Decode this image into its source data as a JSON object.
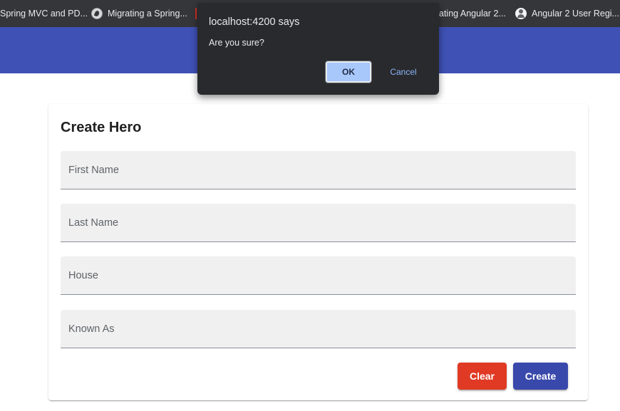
{
  "browser": {
    "bookmarks": [
      {
        "label": "Spring MVC and PD...",
        "icon": "bookmark-icon"
      },
      {
        "label": "Migrating a Spring...",
        "icon": "spring-icon"
      },
      {
        "label": "ating Angular 2...",
        "icon": "bookmark-icon"
      },
      {
        "label": "Angular 2 User Regi...",
        "icon": "user-icon"
      }
    ]
  },
  "dialog": {
    "title": "localhost:4200 says",
    "message": "Are you sure?",
    "ok_label": "OK",
    "cancel_label": "Cancel"
  },
  "form": {
    "title": "Create Hero",
    "fields": [
      {
        "placeholder": "First Name",
        "value": ""
      },
      {
        "placeholder": "Last Name",
        "value": ""
      },
      {
        "placeholder": "House",
        "value": ""
      },
      {
        "placeholder": "Known As",
        "value": ""
      }
    ],
    "clear_label": "Clear",
    "create_label": "Create"
  },
  "colors": {
    "header": "#3f51b5",
    "clear_button": "#e03a24",
    "create_button": "#3949ab",
    "dialog_background": "#292a2d",
    "dialog_ok": "#a8c7fa"
  }
}
